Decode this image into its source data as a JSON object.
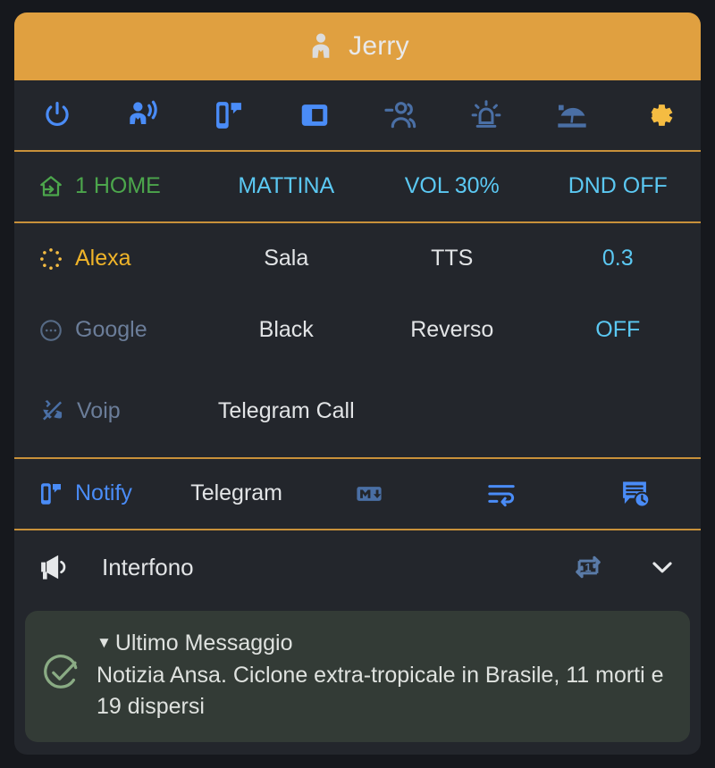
{
  "header": {
    "icon": "account-tie-icon",
    "title": "Jerry"
  },
  "toolbar": {
    "buttons": [
      {
        "name": "power-icon",
        "label": "Power",
        "state": "active"
      },
      {
        "name": "account-voice-icon",
        "label": "Announce",
        "state": "active"
      },
      {
        "name": "cellphone-message-icon",
        "label": "Notify",
        "state": "active"
      },
      {
        "name": "square-inset-icon",
        "label": "Display",
        "state": "active"
      },
      {
        "name": "account-minus-icon",
        "label": "Guest",
        "state": "inactive"
      },
      {
        "name": "alarm-light-icon",
        "label": "Alarm",
        "state": "inactive"
      },
      {
        "name": "beach-icon",
        "label": "Vacation",
        "state": "inactive"
      },
      {
        "name": "gear-icon",
        "label": "Settings",
        "state": "settings"
      }
    ]
  },
  "status_row": {
    "home_icon": "home-import-outline-icon",
    "home": "1 HOME",
    "period": "MATTINA",
    "volume": "VOL 30%",
    "dnd": "DND OFF"
  },
  "alexa_row": {
    "icon": "alexa-dots-icon",
    "label": "Alexa",
    "target": "Sala",
    "mode": "TTS",
    "value": "0.3"
  },
  "google_row": {
    "icon": "dots-circle-icon",
    "label": "Google",
    "target": "Black",
    "mode": "Reverso",
    "value": "OFF"
  },
  "voip_row": {
    "icon": "phone-off-icon",
    "label": "Voip",
    "target": "Telegram Call"
  },
  "notify_row": {
    "icon": "cellphone-message-icon",
    "label": "Notify",
    "service": "Telegram",
    "markdown_icon": "language-markdown-icon",
    "wrap_icon": "text-wrap-icon",
    "history_icon": "message-text-clock-icon"
  },
  "interfono": {
    "icon": "bullhorn-icon",
    "label": "Interfono",
    "repeat_icon": "repeat-once-icon",
    "expand_icon": "chevron-down-icon"
  },
  "message": {
    "status_icon": "check-circle-outline-icon",
    "caret": "▼",
    "title": "Ultimo Messaggio",
    "body": "Notizia Ansa. Ciclone extra-tropicale in Brasile, 11 morti e 19 dispersi"
  },
  "colors": {
    "accent_orange": "#e0a040",
    "divider_orange": "#c8913a",
    "card_bg": "#23262c",
    "page_bg": "#16181d",
    "active_blue": "#4a8cf7",
    "inactive_blue": "#4a6fa5",
    "cyan": "#5bc8f2",
    "green": "#4ca64c",
    "amber": "#f0b429",
    "message_bg": "#333b36",
    "message_green": "#8aab84"
  }
}
